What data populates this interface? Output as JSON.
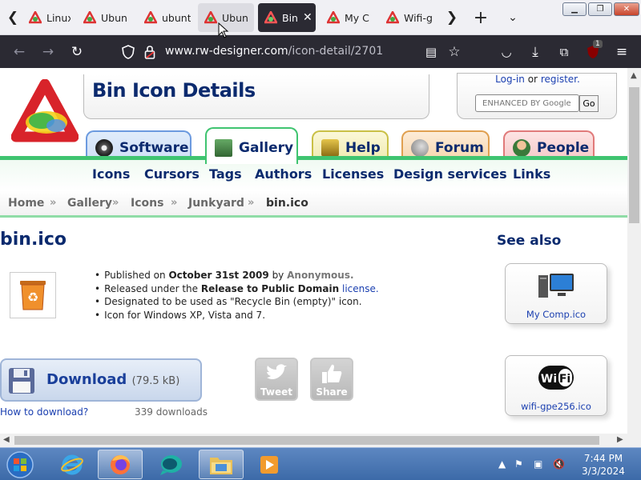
{
  "browser": {
    "tabs": [
      {
        "title": "Linux"
      },
      {
        "title": "Ubun"
      },
      {
        "title": "ubunt"
      },
      {
        "title": "Ubun"
      },
      {
        "title": "Bin"
      },
      {
        "title": "My C"
      },
      {
        "title": "Wifi-g"
      }
    ],
    "url_domain": "www.rw-designer.com",
    "url_path": "/icon-detail/2701",
    "extension_badge": "1"
  },
  "header": {
    "title": "Bin Icon Details",
    "login_label": "Log-in",
    "or_label": "or",
    "register_label": "register.",
    "search_placeholder": "ENHANCED BY Google",
    "go_label": "Go"
  },
  "main_tabs": [
    {
      "label": "Software"
    },
    {
      "label": "Gallery"
    },
    {
      "label": "Help"
    },
    {
      "label": "Forum"
    },
    {
      "label": "People"
    }
  ],
  "subnav": [
    "Icons",
    "Cursors",
    "Tags",
    "Authors",
    "Licenses",
    "Design services",
    "Links"
  ],
  "breadcrumb": [
    "Home",
    "Gallery",
    "Icons",
    "Junkyard",
    "bin.ico"
  ],
  "content": {
    "filename": "bin.ico",
    "info": {
      "published_prefix": "Published on",
      "published_date": "October 31st 2009",
      "published_by": "by",
      "author": "Anonymous.",
      "license_prefix": "Released under the",
      "license_name": "Release to Public Domain",
      "license_link": "license.",
      "usage": "Designated to be used as \"Recycle Bin (empty)\" icon.",
      "platforms": "Icon for Windows XP, Vista and 7."
    },
    "download_label": "Download",
    "download_size": "(79.5 kB)",
    "how_to_download": "How to download?",
    "download_count": "339 downloads",
    "tweet_label": "Tweet",
    "share_label": "Share"
  },
  "see_also": {
    "title": "See also",
    "items": [
      {
        "label": "My Comp.ico"
      },
      {
        "label": "wifi-gpe256.ico"
      }
    ]
  },
  "taskbar": {
    "time": "7:44 PM",
    "date": "3/3/2024"
  },
  "colors": {
    "brand_navy": "#0b2a6e",
    "gallery_green": "#3fc470",
    "link_blue": "#1a3fb0",
    "browser_dark": "#2b2a33"
  }
}
